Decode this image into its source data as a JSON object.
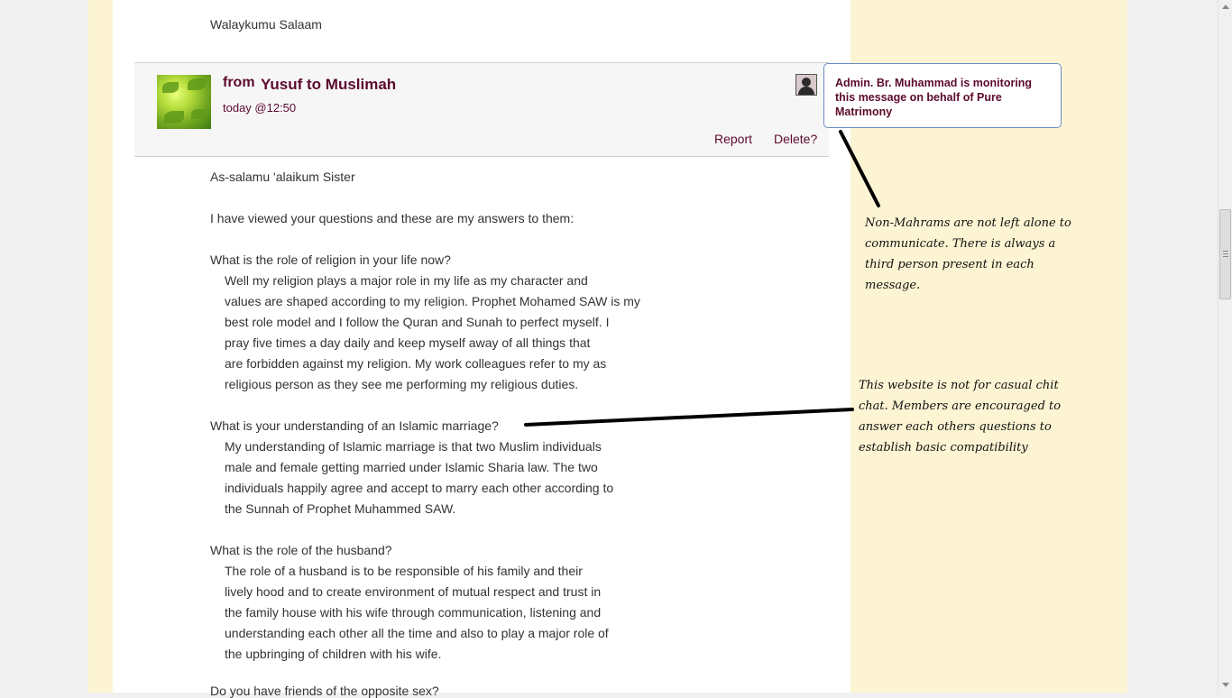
{
  "previous_message": {
    "closing": "Walaykumu Salaam"
  },
  "message": {
    "from_label": "from",
    "from_names": "Yusuf to Muslimah",
    "time": "today @12:50",
    "report_label": "Report",
    "delete_label": "Delete?",
    "greeting": "As-salamu 'alaikum Sister",
    "intro": "I have viewed your questions and these are my answers to them:",
    "q1": "What is the role of religion in your life now?",
    "a1": [
      "Well my religion plays a major role in my life as my character and",
      "values are shaped according to my religion. Prophet Mohamed SAW is my",
      "best role model and I follow the Quran and Sunah to perfect myself. I",
      "pray five times a day daily and keep myself away of all things that",
      "are forbidden against my religion. My work colleagues refer to my as",
      "religious person as they see me performing my religious duties."
    ],
    "q2": "What is your understanding of an Islamic marriage?",
    "a2": [
      "My understanding of Islamic marriage is that two Muslim individuals",
      "male and female getting married under Islamic Sharia law. The two",
      "individuals happily agree and accept to marry each other according to",
      "the Sunnah of Prophet Muhammed SAW."
    ],
    "q3": "What is the role of the husband?",
    "a3": [
      "The role of a husband is to be responsible of his family and their",
      "lively hood and to create environment of mutual respect and trust in",
      "the family house with his wife through communication, listening and",
      "understanding each other all the time and also to play a major role of",
      "the upbringing of children with his wife."
    ],
    "q4_partial": "Do you have friends of the opposite sex?"
  },
  "admin_tooltip": "Admin. Br. Muhammad is monitoring this message on behalf of Pure Matrimony",
  "annotations": {
    "note1": "Non-Mahrams are not left alone to communicate.  There is always a third person present in each message.",
    "note2": "This website is not for casual chit chat. Members are encouraged to answer each others questions to establish basic compatibility"
  },
  "colors": {
    "accent": "#5c0a2e",
    "sidebar_bg": "#fdf4d3",
    "tooltip_border": "#6b8bc2"
  },
  "icons": {
    "avatar": "leaf-avatar-image",
    "admin": "admin-user-icon"
  }
}
